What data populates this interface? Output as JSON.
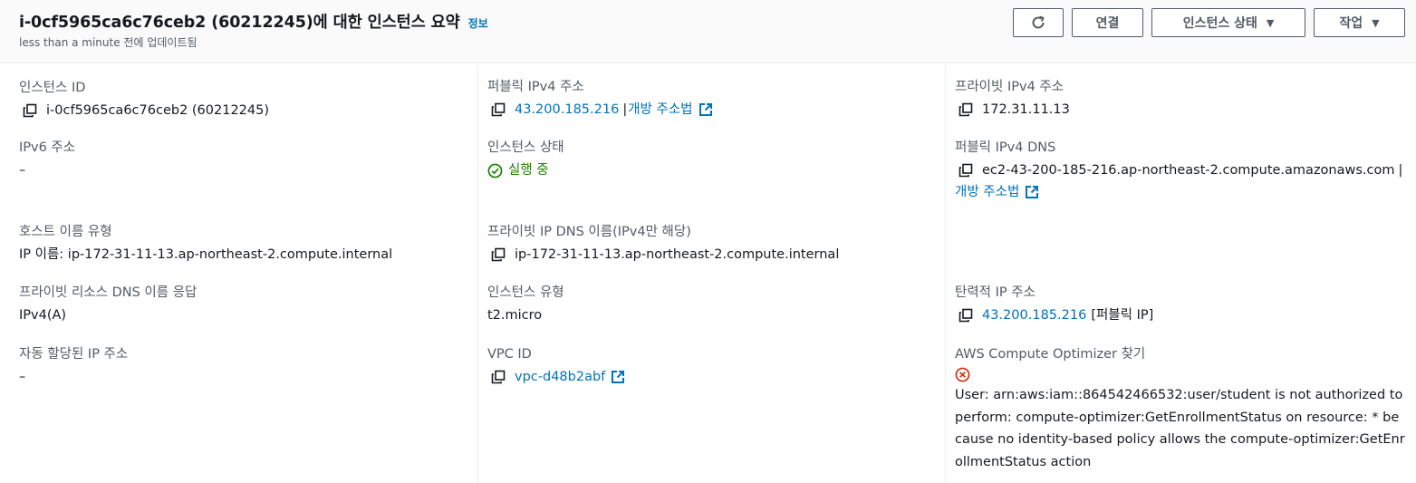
{
  "header": {
    "title": "i-0cf5965ca6c76ceb2 (60212245)에 대한 인스턴스 요약",
    "info_link": "정보",
    "subtitle": "less than a minute 전에 업데이트됨",
    "buttons": {
      "refresh_icon": "refresh-icon",
      "connect": "연결",
      "instance_state": "인스턴스 상태",
      "actions": "작업"
    }
  },
  "columns": {
    "col1": {
      "instance_id": {
        "label": "인스턴스 ID",
        "value": "i-0cf5965ca6c76ceb2 (60212245)"
      },
      "ipv6": {
        "label": "IPv6 주소",
        "value": "–"
      },
      "hostname_type": {
        "label": "호스트 이름 유형",
        "value": "IP 이름: ip-172-31-11-13.ap-northeast-2.compute.internal"
      },
      "private_dns_answer": {
        "label": "프라이빗 리소스 DNS 이름 응답",
        "value": "IPv4(A)"
      },
      "auto_ip": {
        "label": "자동 할당된 IP 주소",
        "value": "–"
      }
    },
    "col2": {
      "public_ipv4": {
        "label": "퍼블릭 IPv4 주소",
        "value": "43.200.185.216",
        "separator": "|",
        "link": "개방 주소법"
      },
      "instance_state": {
        "label": "인스턴스 상태",
        "value": "실행 중"
      },
      "private_ip_dns": {
        "label": "프라이빗 IP DNS 이름(IPv4만 해당)",
        "value": "ip-172-31-11-13.ap-northeast-2.compute.internal"
      },
      "instance_type": {
        "label": "인스턴스 유형",
        "value": "t2.micro"
      },
      "vpc_id": {
        "label": "VPC ID",
        "value": "vpc-d48b2abf"
      }
    },
    "col3": {
      "private_ipv4": {
        "label": "프라이빗 IPv4 주소",
        "value": "172.31.11.13"
      },
      "public_ipv4_dns": {
        "label": "퍼블릭 IPv4 DNS",
        "value": "ec2-43-200-185-216.ap-northeast-2.compute.amazonaws.com",
        "separator": "|",
        "link": "개방 주소법"
      },
      "elastic_ip": {
        "label": "탄력적 IP 주소",
        "value": "43.200.185.216",
        "suffix": "[퍼블릭 IP]"
      },
      "compute_optimizer": {
        "label": "AWS Compute Optimizer 찾기",
        "error": "User: arn:aws:iam::864542466532:user/student is not authorized to perform: compute-optimizer:GetEnrollmentStatus on resource: * because no identity-based policy allows the compute-optimizer:GetEnrollmentStatus action"
      }
    }
  },
  "colors": {
    "link": "#0073bb",
    "success": "#1d8102",
    "error": "#d13212",
    "label": "#545b64",
    "text": "#16191f"
  }
}
